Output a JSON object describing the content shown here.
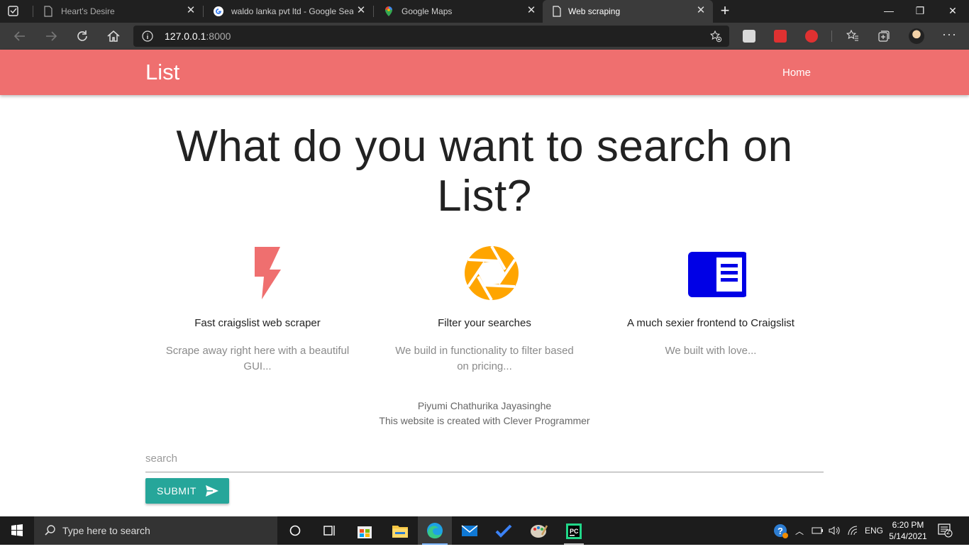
{
  "browser": {
    "tabs": [
      {
        "title": "Heart's Desire"
      },
      {
        "title": "waldo lanka pvt ltd - Google Sea"
      },
      {
        "title": "Google Maps"
      },
      {
        "title": "Web scraping"
      }
    ],
    "url_host": "127.0.0.1",
    "url_port": ":8000"
  },
  "header": {
    "brand": "List",
    "nav_home": "Home"
  },
  "main": {
    "headline": "What do you want to search on List?",
    "features": [
      {
        "icon": "flash-icon",
        "color": "#ef6f6f",
        "title": "Fast craigslist web scraper",
        "description": "Scrape away right here with a beautiful GUI..."
      },
      {
        "icon": "camera-aperture-icon",
        "color": "#ffa500",
        "title": "Filter your searches",
        "description": "We build in functionality to filter based on pricing..."
      },
      {
        "icon": "chrome-reader-mode-icon",
        "color": "#0000e6",
        "title": "A much sexier frontend to Craigslist",
        "description": "We built with love..."
      }
    ],
    "credits": {
      "author": "Piyumi Chathurika Jayasinghe",
      "note": "This website is created with Clever Programmer"
    }
  },
  "search": {
    "placeholder": "search",
    "value": "",
    "submit_label": "SUBMIT"
  },
  "taskbar": {
    "search_placeholder": "Type here to search",
    "language": "ENG",
    "time": "6:20 PM",
    "date": "5/14/2021",
    "notifications": "2"
  },
  "colors": {
    "header": "#ef6f6f",
    "button": "#26a69a"
  }
}
